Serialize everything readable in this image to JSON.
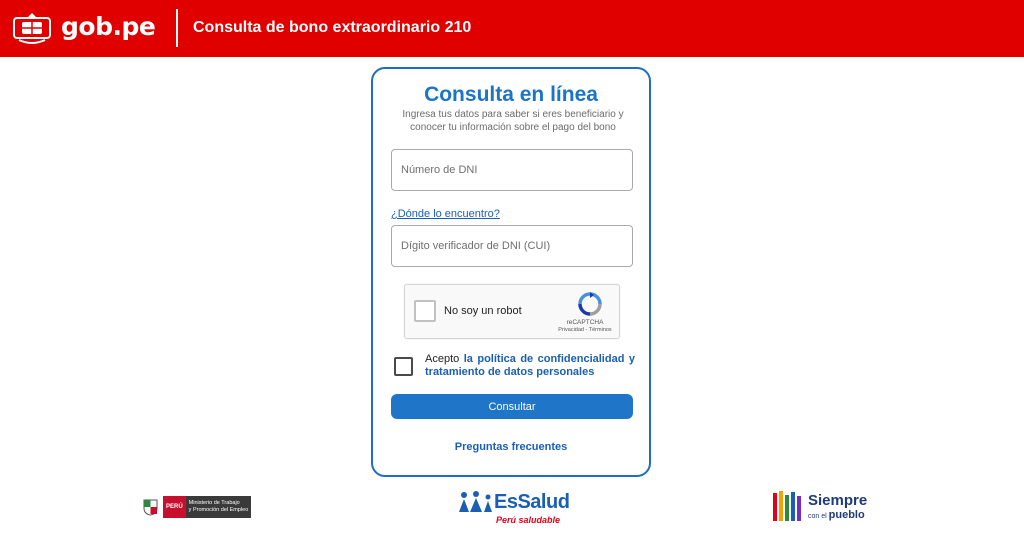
{
  "header": {
    "brand": "gob.pe",
    "title": "Consulta de bono extraordinario 210",
    "background": "#e00000"
  },
  "form": {
    "title": "Consulta en línea",
    "subtitle": "Ingresa tus datos para saber si eres beneficiario y conocer tu información sobre el pago del bono",
    "dni_placeholder": "Número de DNI",
    "dni_value": "",
    "help_link": "¿Dónde lo encuentro?",
    "cui_placeholder": "Dígito verificador de DNI (CUI)",
    "cui_value": "",
    "captcha": {
      "label": "No soy un robot",
      "brand": "reCAPTCHA",
      "links": "Privacidad - Términos",
      "checked": false
    },
    "accept": {
      "prefix": "Acepto ",
      "link": "la política de confidencialidad y tratamiento de datos personales",
      "checked": false
    },
    "submit_label": "Consultar",
    "faq_link": "Preguntas frecuentes",
    "accent": "#1f76c8"
  },
  "footer": {
    "mintra": {
      "peru": "PERÚ",
      "name_line1": "Ministerio de Trabajo",
      "name_line2": "y Promoción del Empleo"
    },
    "essalud": {
      "name": "EsSalud",
      "tagline": "Perú saludable"
    },
    "siempre": {
      "main": "Siempre",
      "sub_prefix": "con el",
      "sub_main": "pueblo"
    }
  }
}
